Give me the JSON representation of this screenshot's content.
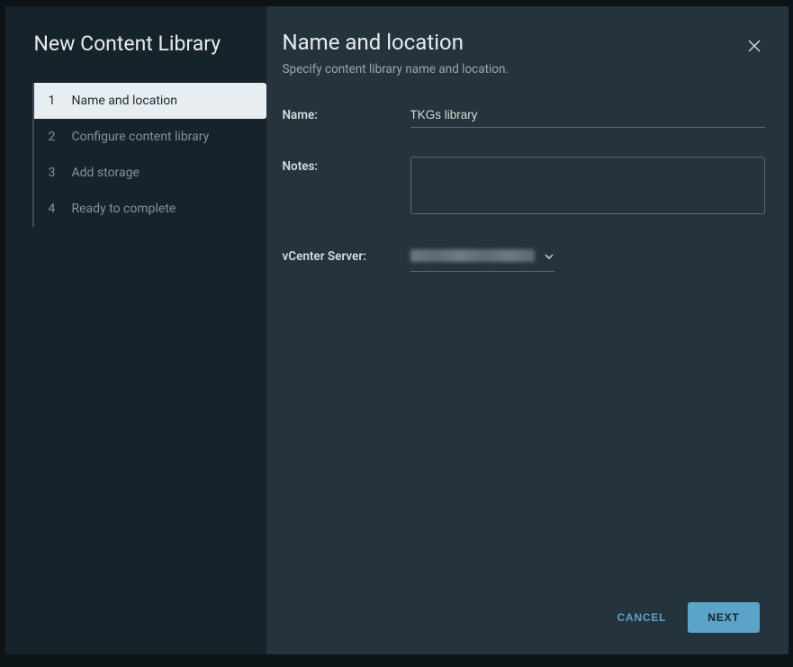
{
  "sidebar": {
    "title": "New Content Library",
    "steps": [
      {
        "number": "1",
        "label": "Name and location",
        "active": true
      },
      {
        "number": "2",
        "label": "Configure content library",
        "active": false
      },
      {
        "number": "3",
        "label": "Add storage",
        "active": false
      },
      {
        "number": "4",
        "label": "Ready to complete",
        "active": false
      }
    ]
  },
  "main": {
    "title": "Name and location",
    "subtitle": "Specify content library name and location.",
    "form": {
      "name_label": "Name:",
      "name_value": "TKGs library",
      "notes_label": "Notes:",
      "notes_value": "",
      "vcenter_label": "vCenter Server:",
      "vcenter_value": ""
    }
  },
  "footer": {
    "cancel_label": "CANCEL",
    "next_label": "NEXT"
  }
}
